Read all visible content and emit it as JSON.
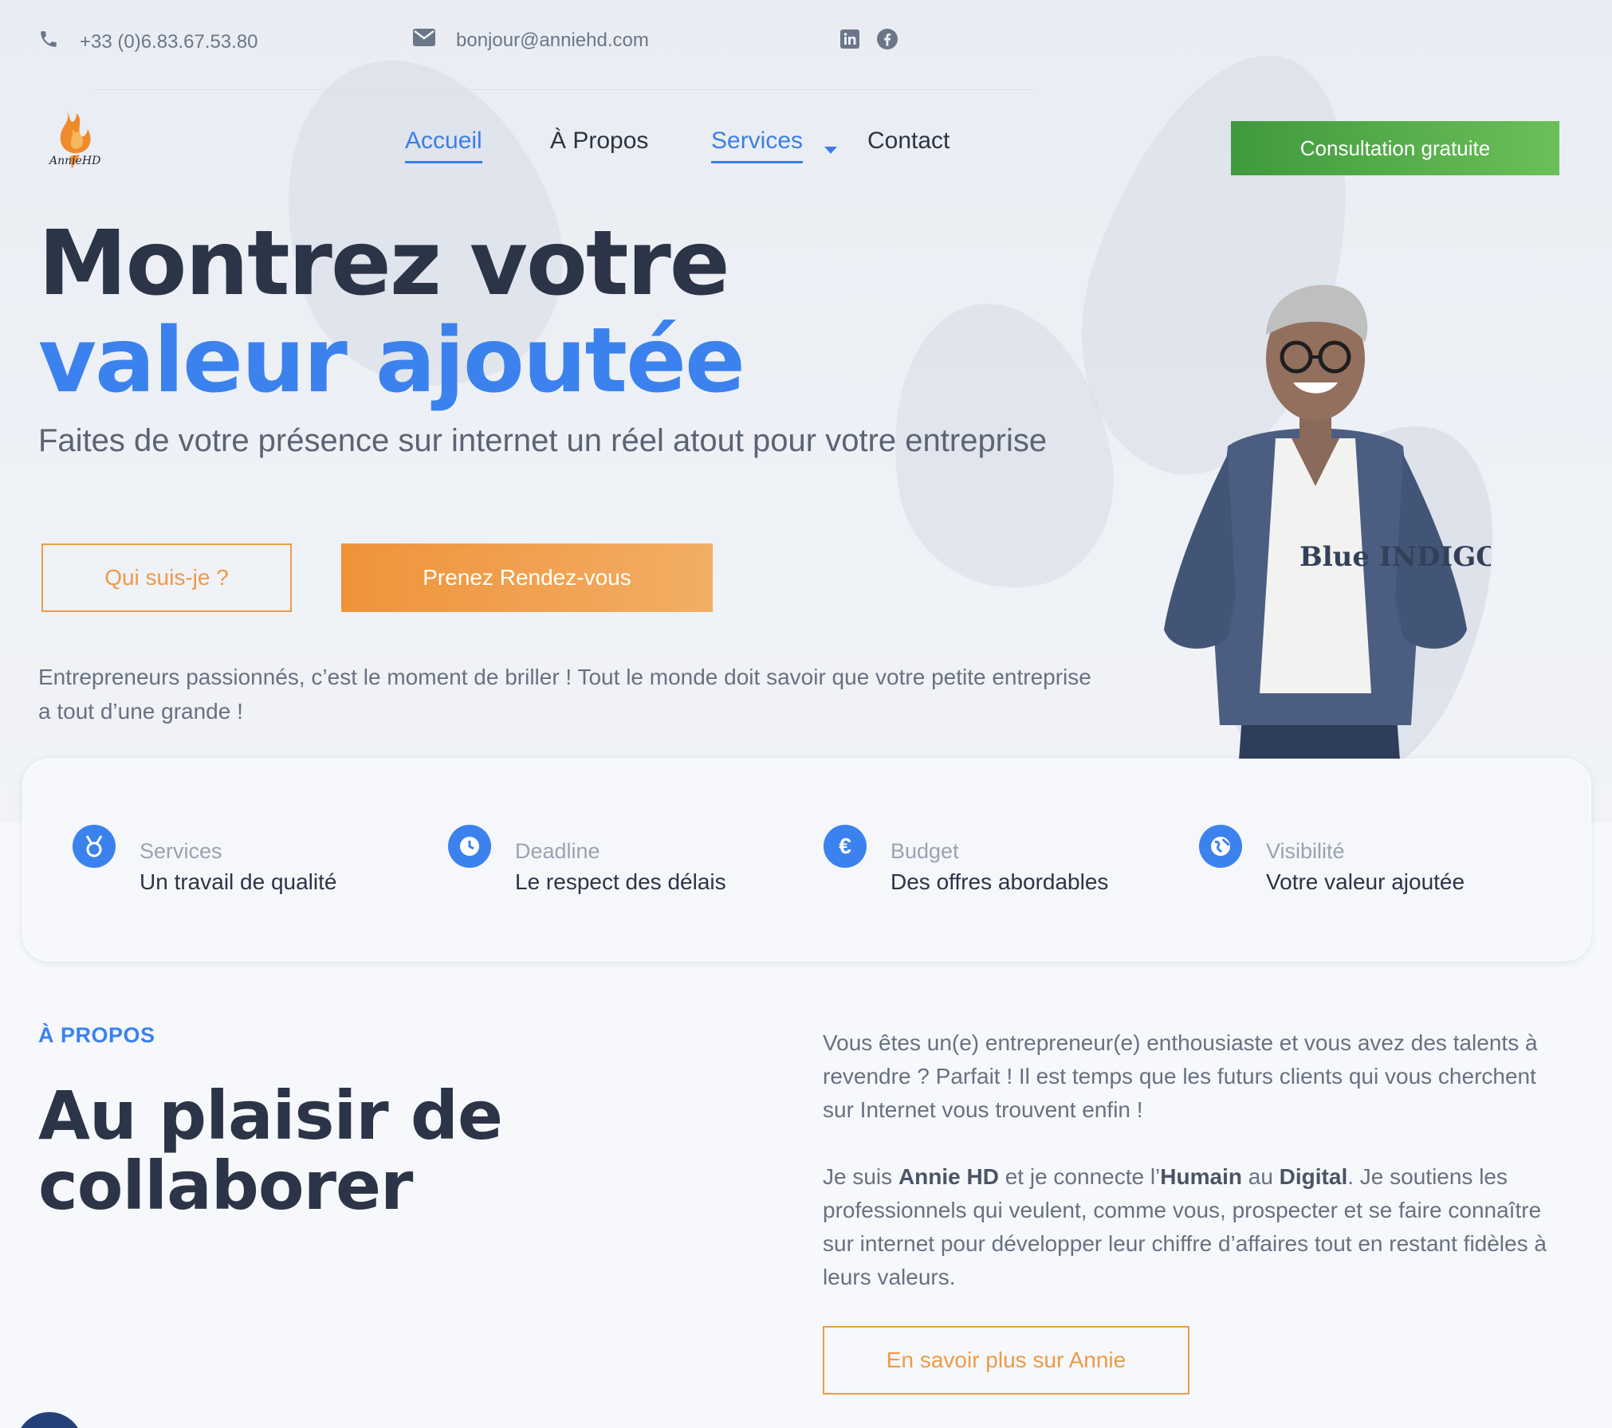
{
  "topbar": {
    "phone": "+33 (0)6.83.67.53.80",
    "email": "bonjour@anniehd.com",
    "phone_icon": "phone-icon",
    "email_icon": "envelope-icon",
    "social_icons": [
      "linkedin-icon",
      "facebook-icon"
    ]
  },
  "logo": {
    "text": "AnnieHD"
  },
  "nav": {
    "items": [
      {
        "label": "Accueil"
      },
      {
        "label": "À Propos"
      },
      {
        "label": "Services"
      },
      {
        "label": "Contact"
      }
    ],
    "cta": "Consultation gratuite"
  },
  "hero": {
    "title_line1": "Montrez votre",
    "title_line2": "valeur ajoutée",
    "subtitle": "Faites de votre présence sur internet un réel atout pour votre entreprise",
    "btn_who": "Qui suis-je ?",
    "btn_rdv": "Prenez Rendez-vous",
    "paragraph": "Entrepreneurs passionnés, c’est le moment de briller ! Tout le monde doit savoir que votre petite entreprise a tout d’une grande !",
    "shirt_text": "Blue INDIGO"
  },
  "features": [
    {
      "title": "Services",
      "desc": "Un travail de qualité",
      "icon": "medal-icon"
    },
    {
      "title": "Deadline",
      "desc": "Le respect des délais",
      "icon": "clock-icon"
    },
    {
      "title": "Budget",
      "desc": "Des offres abordables",
      "icon": "euro-icon"
    },
    {
      "title": "Visibilité",
      "desc": "Votre valeur ajoutée",
      "icon": "globe-icon"
    }
  ],
  "about": {
    "eyebrow": "À PROPOS",
    "heading": "Au plaisir de collaborer",
    "p1": "Vous êtes un(e) entrepreneur(e) enthousiaste et vous avez des talents à revendre ? Parfait ! Il est temps que les futurs clients qui vous cherchent sur Internet vous trouvent enfin !",
    "p2_a": "Je suis ",
    "p2_b": "Annie HD",
    "p2_c": " et je connecte l’",
    "p2_d": "Humain",
    "p2_e": " au ",
    "p2_f": "Digital",
    "p2_g": ". Je soutiens les professionnels qui veulent, comme vous, prospecter et se faire connaître sur internet pour développer leur chiffre d’affaires tout en restant fidèles à leurs valeurs.",
    "btn": "En savoir plus sur Annie"
  },
  "colors": {
    "accent_blue": "#3b82ee",
    "accent_orange": "#ef9a48",
    "accent_green": "#3f9a3d",
    "heading_dark": "#2c3447"
  }
}
